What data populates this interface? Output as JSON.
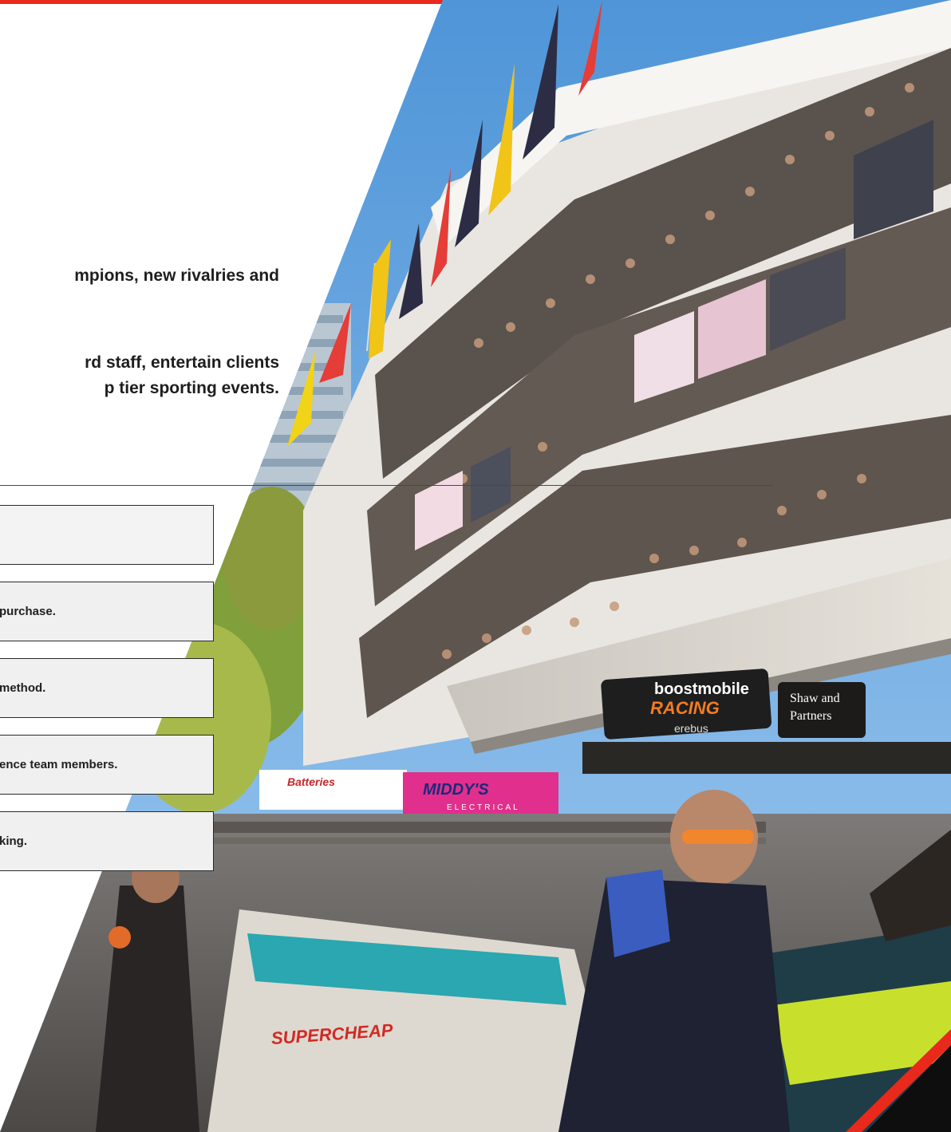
{
  "intro": {
    "paragraph_1": "mpions, new rivalries and",
    "paragraph_2_line_1": "rd staff, entertain clients",
    "paragraph_2_line_2": "p tier sporting events."
  },
  "steps": [
    {
      "text": ""
    },
    {
      "text": "purchase."
    },
    {
      "text": "method."
    },
    {
      "text": "ence team members."
    },
    {
      "text": "king."
    }
  ],
  "photo": {
    "signs": {
      "boost_top": "boostmobile",
      "boost_bottom": "RACING",
      "erebus": "erebus",
      "shaw_1": "Shaw and",
      "shaw_2": "Partners",
      "rj": "Batteries",
      "middys": "MIDDY'S",
      "middys_sub": "ELECTRICAL",
      "supercheap": "SUPERCHEAP"
    }
  },
  "colors": {
    "accent": "#e8291c",
    "sky": "#6aa8e0",
    "box_fill": "#f0f0f0"
  }
}
